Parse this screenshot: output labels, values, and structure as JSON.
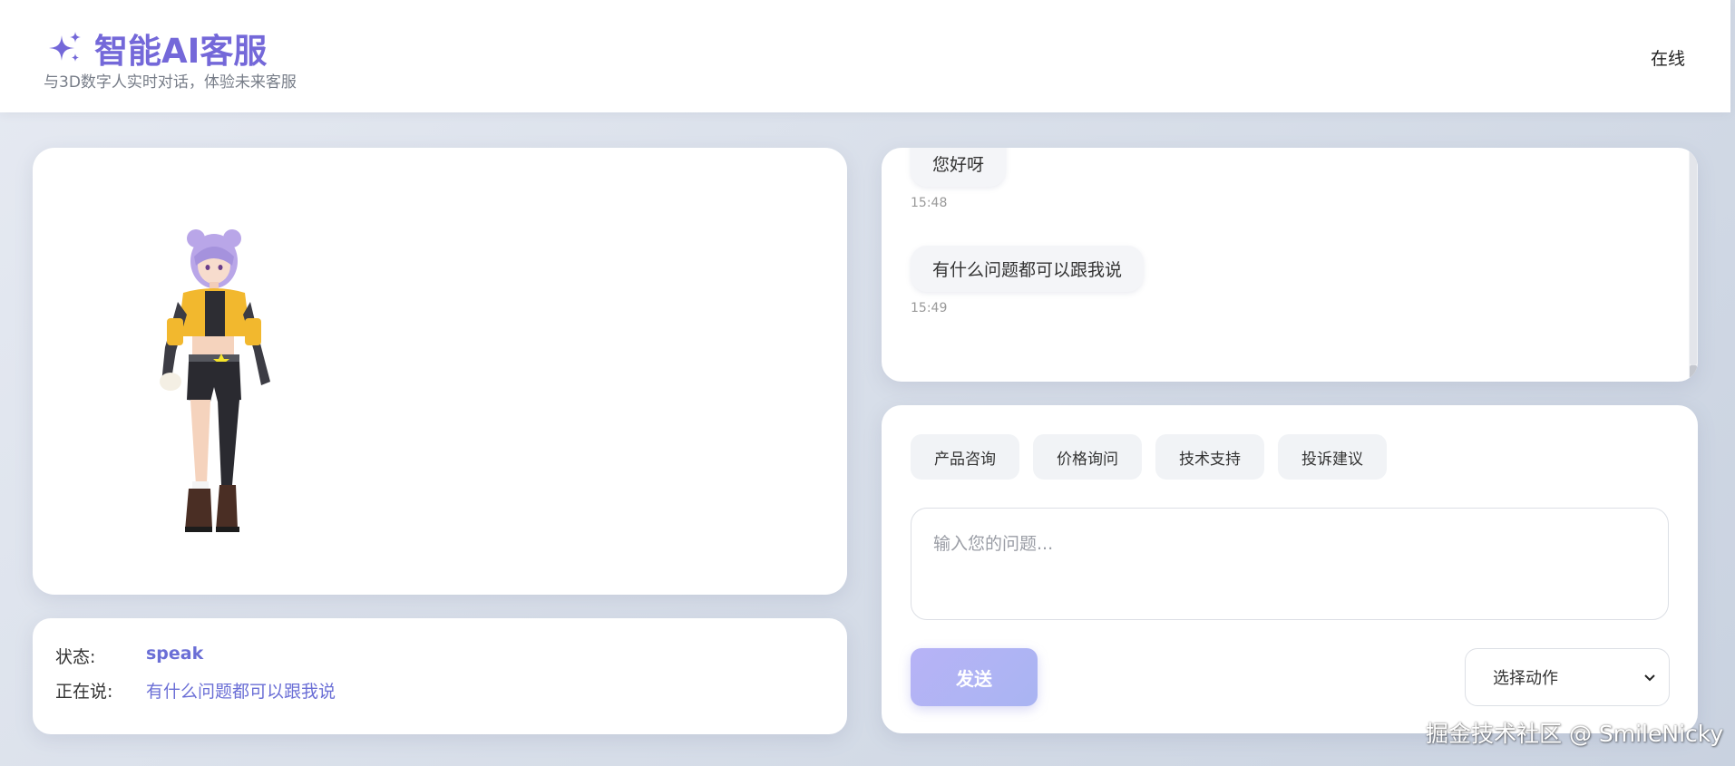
{
  "header": {
    "logo_icon": "sparkles-icon",
    "title": "智能AI客服",
    "subtitle": "与3D数字人实时对话，体验未来客服",
    "online_status": "在线"
  },
  "colors": {
    "accent": "#7468d9",
    "status_value": "#6b6fd6",
    "send_button": "#b7b3f6"
  },
  "status": {
    "state_label": "状态:",
    "state_value": "speak",
    "speaking_label": "正在说:",
    "speaking_value": "有什么问题都可以跟我说"
  },
  "chat": {
    "messages": [
      {
        "text": "您好呀",
        "time": "15:48"
      },
      {
        "text": "有什么问题都可以跟我说",
        "time": "15:49"
      }
    ]
  },
  "input": {
    "quick_buttons": [
      "产品咨询",
      "价格询问",
      "技术支持",
      "投诉建议"
    ],
    "placeholder": "输入您的问题...",
    "send_label": "发送",
    "action_select": "选择动作"
  },
  "watermark": "掘金技术社区 @ SmileNicky"
}
